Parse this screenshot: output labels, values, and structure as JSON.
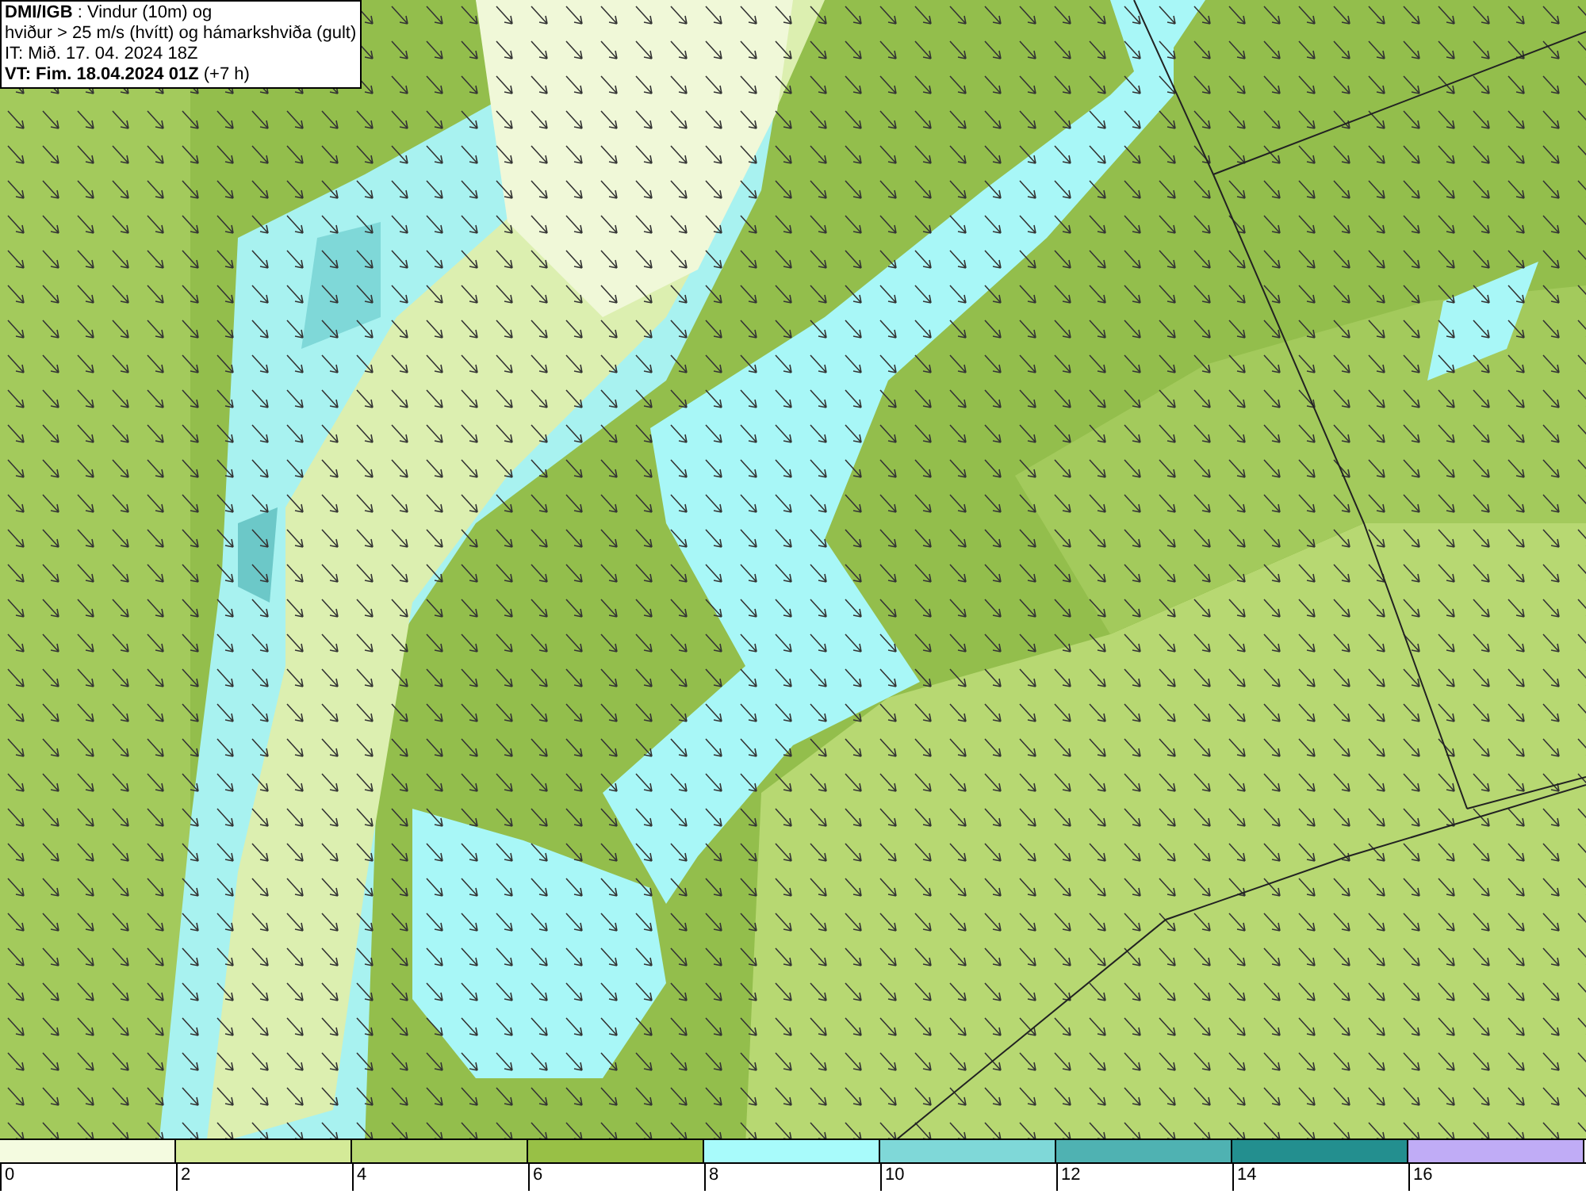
{
  "title_box": {
    "lines": [
      "**DMI/IGB** : Vindur (10m) og",
      "hviður > 25 m/s (hvítt) og hámarkshviða (gult)",
      "IT: Mið. 17. 04. 2024 18Z",
      "**VT: Fim. 18.04.2024 01Z** (+7 h)"
    ]
  },
  "legend": {
    "bins": [
      {
        "color": "#f4fbe0"
      },
      {
        "color": "#d4ea98"
      },
      {
        "color": "#b7d872"
      },
      {
        "color": "#98c046"
      },
      {
        "color": "#a8fbfb"
      },
      {
        "color": "#7fd8d8"
      },
      {
        "color": "#4fb2b2"
      },
      {
        "color": "#238f8f"
      },
      {
        "color": "#c0acf6"
      }
    ],
    "labels": [
      "0",
      "2",
      "4",
      "6",
      "8",
      "10",
      "12",
      "14",
      "16"
    ]
  }
}
